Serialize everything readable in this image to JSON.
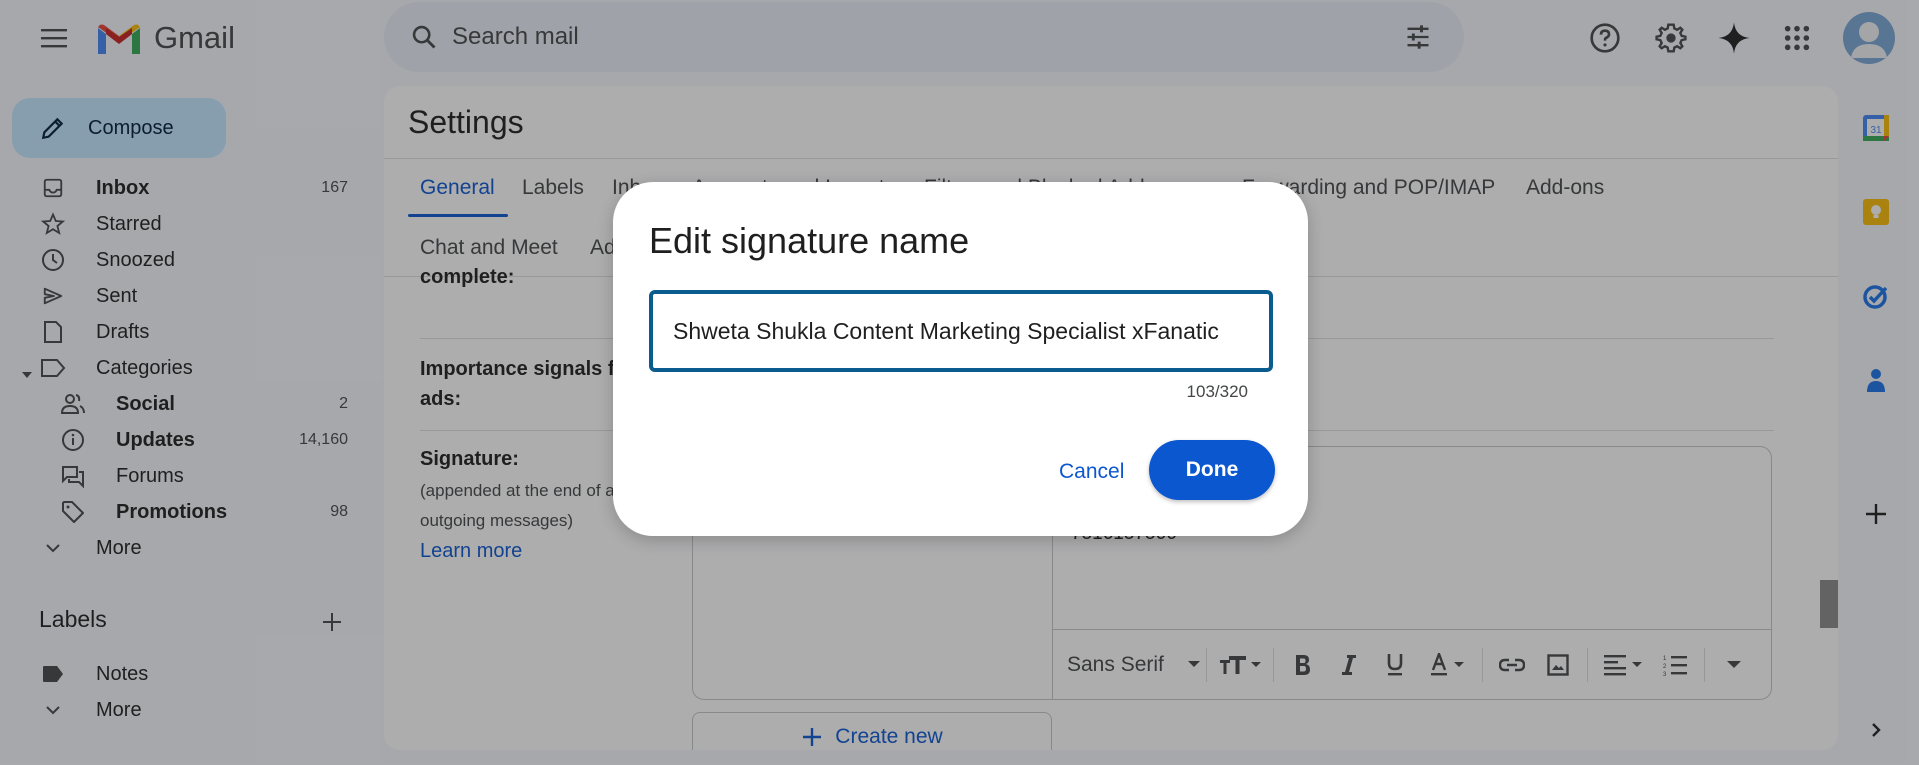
{
  "app": {
    "name": "Gmail"
  },
  "header": {
    "search_placeholder": "Search mail",
    "icons": [
      "menu-icon",
      "search-icon",
      "search-options-icon",
      "help-icon",
      "settings-icon",
      "gemini-icon",
      "apps-icon",
      "account-avatar"
    ]
  },
  "compose": {
    "label": "Compose"
  },
  "nav": {
    "items": [
      {
        "label": "Inbox",
        "count": "167",
        "icon": "inbox-icon",
        "bold": true
      },
      {
        "label": "Starred",
        "count": "",
        "icon": "star-icon"
      },
      {
        "label": "Snoozed",
        "count": "",
        "icon": "clock-icon"
      },
      {
        "label": "Sent",
        "count": "",
        "icon": "send-icon"
      },
      {
        "label": "Drafts",
        "count": "",
        "icon": "draft-icon"
      },
      {
        "label": "Categories",
        "count": "",
        "icon": "label-icon"
      }
    ],
    "categories": [
      {
        "label": "Social",
        "count": "2",
        "icon": "people-icon",
        "bold": true
      },
      {
        "label": "Updates",
        "count": "14,160",
        "icon": "info-icon",
        "bold": true
      },
      {
        "label": "Forums",
        "count": "",
        "icon": "forum-icon"
      },
      {
        "label": "Promotions",
        "count": "98",
        "icon": "tag-icon",
        "bold": true
      }
    ],
    "more_label": "More"
  },
  "labels": {
    "heading": "Labels",
    "items": [
      {
        "label": "Notes"
      }
    ],
    "more_label": "More"
  },
  "settings": {
    "title": "Settings",
    "tabs_row1": [
      "General",
      "Labels",
      "Inbox",
      "Accounts and Import",
      "Filters and Blocked Addresses",
      "Forwarding and POP/IMAP",
      "Add-ons"
    ],
    "tabs_row2": [
      "Chat and Meet",
      "Advanced"
    ],
    "active_tab": "General",
    "rows": {
      "complete_label": "complete:",
      "importance_label": "Importance signals for ads:",
      "signature_label": "Signature:",
      "signature_sub": "(appended at the end of all outgoing messages)",
      "learn_more": "Learn more"
    },
    "signature_preview_text": "7516157566",
    "create_new": "Create new",
    "toolbar": {
      "font": "Sans Serif",
      "buttons": [
        "font-size",
        "bold",
        "italic",
        "underline",
        "text-color",
        "link",
        "image",
        "align",
        "numbered-list",
        "more-formatting"
      ]
    }
  },
  "dialog": {
    "title": "Edit signature name",
    "input_value": "Shweta Shukla Content Marketing Specialist xFanatic",
    "counter": "103/320",
    "cancel_label": "Cancel",
    "done_label": "Done"
  },
  "colors": {
    "accent": "#0b57d0",
    "compose_bg": "#c2e7ff",
    "input_border": "#0b5c8e"
  }
}
